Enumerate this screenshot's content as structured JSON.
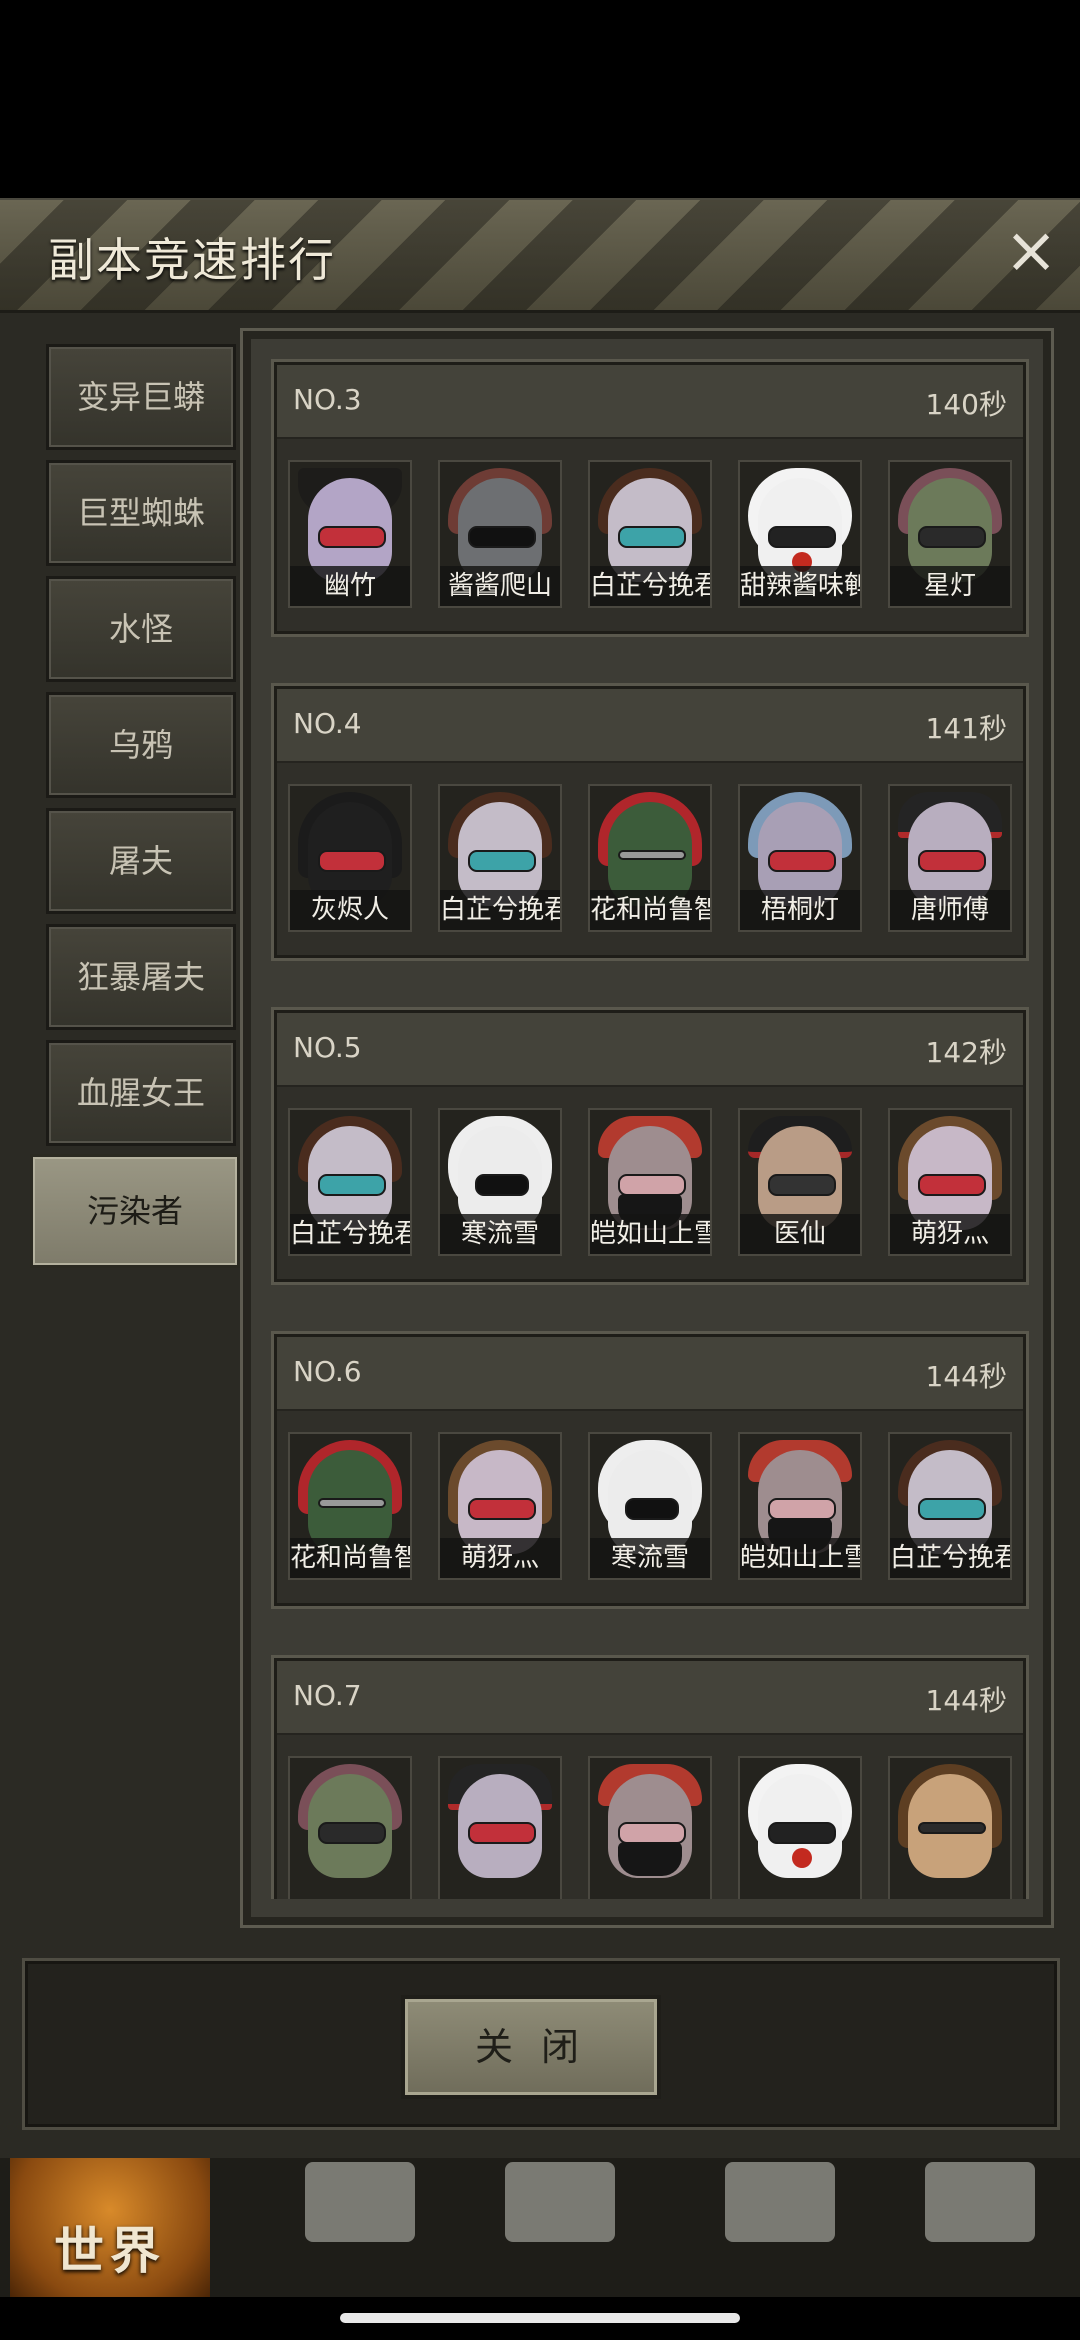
{
  "dialog": {
    "title": "副本竞速排行",
    "close_icon": "×",
    "close_button_label": "关 闭"
  },
  "sidebar": {
    "items": [
      {
        "label": "变异巨蟒",
        "active": false
      },
      {
        "label": "巨型蜘蛛",
        "active": false
      },
      {
        "label": "水怪",
        "active": false
      },
      {
        "label": "乌鸦",
        "active": false
      },
      {
        "label": "屠夫",
        "active": false
      },
      {
        "label": "狂暴屠夫",
        "active": false
      },
      {
        "label": "血腥女王",
        "active": false
      },
      {
        "label": "污染者",
        "active": true
      }
    ]
  },
  "rankings": [
    {
      "rank": "NO.3",
      "time": "140秒",
      "members": [
        {
          "name": "幽竹",
          "icon": "pirate-hat-avatar"
        },
        {
          "name": "酱酱爬山",
          "icon": "cyborg-avatar"
        },
        {
          "name": "白芷兮挽君",
          "icon": "maid-avatar"
        },
        {
          "name": "甜辣酱味鹌",
          "icon": "clown-mask-avatar"
        },
        {
          "name": "星灯",
          "icon": "bunny-gasmask-avatar"
        }
      ]
    },
    {
      "rank": "NO.4",
      "time": "141秒",
      "members": [
        {
          "name": "灰烬人",
          "icon": "hood-avatar"
        },
        {
          "name": "白芷兮挽君",
          "icon": "maid-avatar"
        },
        {
          "name": "花和尚鲁智",
          "icon": "football-helmet-avatar"
        },
        {
          "name": "梧桐灯",
          "icon": "blue-hair-avatar"
        },
        {
          "name": "唐师傅",
          "icon": "officer-cap-avatar"
        }
      ]
    },
    {
      "rank": "NO.5",
      "time": "142秒",
      "members": [
        {
          "name": "白芷兮挽君",
          "icon": "maid-avatar"
        },
        {
          "name": "寒流雪",
          "icon": "ghost-mask-avatar"
        },
        {
          "name": "皑如山上雪",
          "icon": "bandana-avatar"
        },
        {
          "name": "医仙",
          "icon": "medic-cap-avatar"
        },
        {
          "name": "萌犽灬",
          "icon": "brown-hair-avatar"
        }
      ]
    },
    {
      "rank": "NO.6",
      "time": "144秒",
      "members": [
        {
          "name": "花和尚鲁智",
          "icon": "football-helmet-avatar"
        },
        {
          "name": "萌犽灬",
          "icon": "brown-hair-avatar"
        },
        {
          "name": "寒流雪",
          "icon": "ghost-mask-avatar"
        },
        {
          "name": "皑如山上雪",
          "icon": "bandana-avatar"
        },
        {
          "name": "白芷兮挽君",
          "icon": "maid-avatar"
        }
      ]
    },
    {
      "rank": "NO.7",
      "time": "144秒",
      "members": [
        {
          "name": "",
          "icon": "bunny-gasmask-avatar"
        },
        {
          "name": "",
          "icon": "officer-cap-avatar"
        },
        {
          "name": "",
          "icon": "bandana-avatar"
        },
        {
          "name": "",
          "icon": "clown-mask-avatar"
        },
        {
          "name": "",
          "icon": "long-hair-avatar"
        }
      ]
    }
  ],
  "bottom_nav": {
    "world_label": "世界",
    "items": [
      "globe-icon",
      "backpack-icon",
      "head-gear-icon",
      "phone-icon",
      "cart-icon"
    ]
  }
}
